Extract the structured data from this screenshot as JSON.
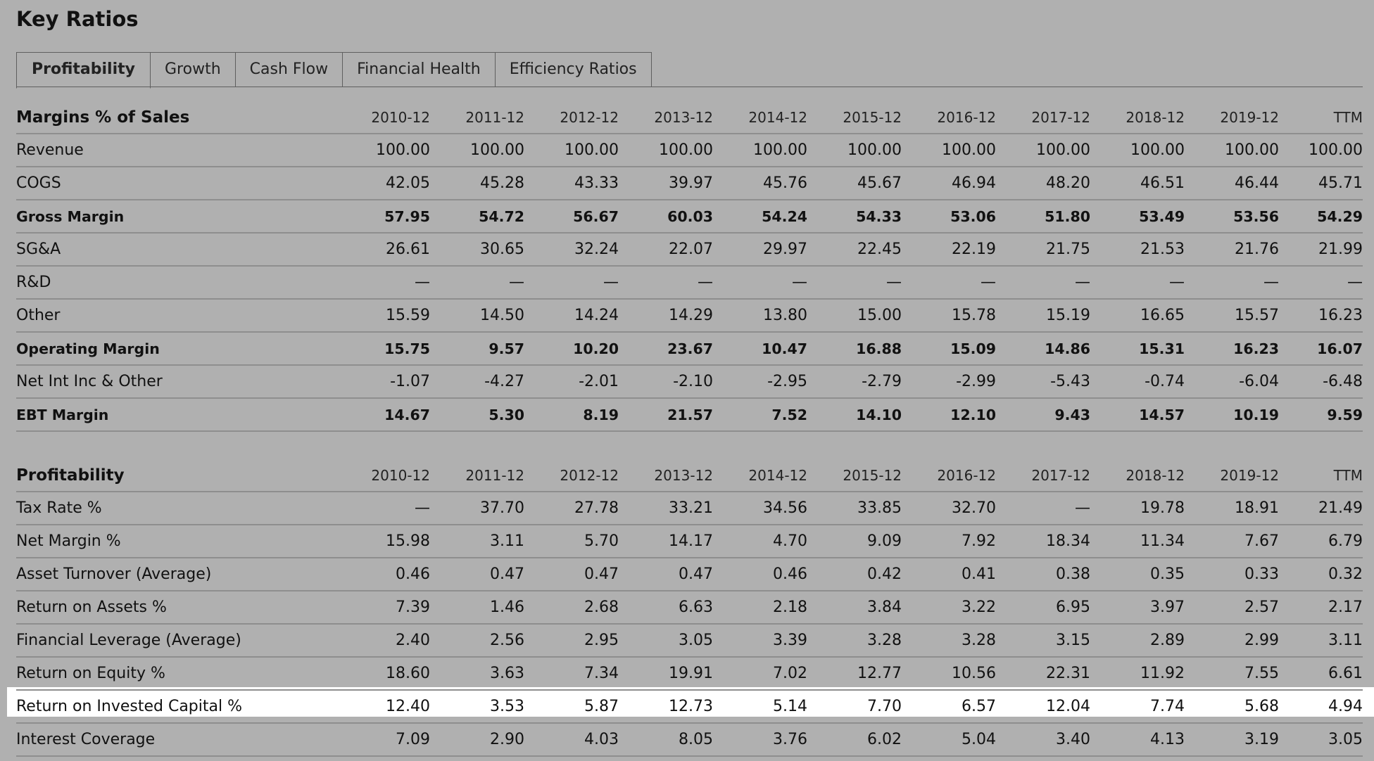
{
  "title": "Key Ratios",
  "tabs": [
    {
      "label": "Profitability",
      "active": true
    },
    {
      "label": "Growth",
      "active": false
    },
    {
      "label": "Cash Flow",
      "active": false
    },
    {
      "label": "Financial Health",
      "active": false
    },
    {
      "label": "Efficiency Ratios",
      "active": false
    }
  ],
  "margins": {
    "heading": "Margins % of Sales",
    "columns": [
      "2010-12",
      "2011-12",
      "2012-12",
      "2013-12",
      "2014-12",
      "2015-12",
      "2016-12",
      "2017-12",
      "2018-12",
      "2019-12",
      "TTM"
    ],
    "rows": [
      {
        "label": "Revenue",
        "bold": false,
        "values": [
          "100.00",
          "100.00",
          "100.00",
          "100.00",
          "100.00",
          "100.00",
          "100.00",
          "100.00",
          "100.00",
          "100.00",
          "100.00"
        ]
      },
      {
        "label": "COGS",
        "bold": false,
        "values": [
          "42.05",
          "45.28",
          "43.33",
          "39.97",
          "45.76",
          "45.67",
          "46.94",
          "48.20",
          "46.51",
          "46.44",
          "45.71"
        ]
      },
      {
        "label": "Gross Margin",
        "bold": true,
        "values": [
          "57.95",
          "54.72",
          "56.67",
          "60.03",
          "54.24",
          "54.33",
          "53.06",
          "51.80",
          "53.49",
          "53.56",
          "54.29"
        ]
      },
      {
        "label": "SG&A",
        "bold": false,
        "values": [
          "26.61",
          "30.65",
          "32.24",
          "22.07",
          "29.97",
          "22.45",
          "22.19",
          "21.75",
          "21.53",
          "21.76",
          "21.99"
        ]
      },
      {
        "label": "R&D",
        "bold": false,
        "values": [
          "—",
          "—",
          "—",
          "—",
          "—",
          "—",
          "—",
          "—",
          "—",
          "—",
          "—"
        ]
      },
      {
        "label": "Other",
        "bold": false,
        "values": [
          "15.59",
          "14.50",
          "14.24",
          "14.29",
          "13.80",
          "15.00",
          "15.78",
          "15.19",
          "16.65",
          "15.57",
          "16.23"
        ]
      },
      {
        "label": "Operating Margin",
        "bold": true,
        "values": [
          "15.75",
          "9.57",
          "10.20",
          "23.67",
          "10.47",
          "16.88",
          "15.09",
          "14.86",
          "15.31",
          "16.23",
          "16.07"
        ]
      },
      {
        "label": "Net Int Inc & Other",
        "bold": false,
        "values": [
          "-1.07",
          "-4.27",
          "-2.01",
          "-2.10",
          "-2.95",
          "-2.79",
          "-2.99",
          "-5.43",
          "-0.74",
          "-6.04",
          "-6.48"
        ]
      },
      {
        "label": "EBT Margin",
        "bold": true,
        "values": [
          "14.67",
          "5.30",
          "8.19",
          "21.57",
          "7.52",
          "14.10",
          "12.10",
          "9.43",
          "14.57",
          "10.19",
          "9.59"
        ]
      }
    ]
  },
  "profitability": {
    "heading": "Profitability",
    "columns": [
      "2010-12",
      "2011-12",
      "2012-12",
      "2013-12",
      "2014-12",
      "2015-12",
      "2016-12",
      "2017-12",
      "2018-12",
      "2019-12",
      "TTM"
    ],
    "rows": [
      {
        "label": "Tax Rate %",
        "highlight": false,
        "values": [
          "—",
          "37.70",
          "27.78",
          "33.21",
          "34.56",
          "33.85",
          "32.70",
          "—",
          "19.78",
          "18.91",
          "21.49"
        ]
      },
      {
        "label": "Net Margin %",
        "highlight": false,
        "values": [
          "15.98",
          "3.11",
          "5.70",
          "14.17",
          "4.70",
          "9.09",
          "7.92",
          "18.34",
          "11.34",
          "7.67",
          "6.79"
        ]
      },
      {
        "label": "Asset Turnover (Average)",
        "highlight": false,
        "values": [
          "0.46",
          "0.47",
          "0.47",
          "0.47",
          "0.46",
          "0.42",
          "0.41",
          "0.38",
          "0.35",
          "0.33",
          "0.32"
        ]
      },
      {
        "label": "Return on Assets %",
        "highlight": false,
        "values": [
          "7.39",
          "1.46",
          "2.68",
          "6.63",
          "2.18",
          "3.84",
          "3.22",
          "6.95",
          "3.97",
          "2.57",
          "2.17"
        ]
      },
      {
        "label": "Financial Leverage (Average)",
        "highlight": false,
        "values": [
          "2.40",
          "2.56",
          "2.95",
          "3.05",
          "3.39",
          "3.28",
          "3.28",
          "3.15",
          "2.89",
          "2.99",
          "3.11"
        ]
      },
      {
        "label": "Return on Equity %",
        "highlight": false,
        "values": [
          "18.60",
          "3.63",
          "7.34",
          "19.91",
          "7.02",
          "12.77",
          "10.56",
          "22.31",
          "11.92",
          "7.55",
          "6.61"
        ]
      },
      {
        "label": "Return on Invested Capital %",
        "highlight": true,
        "values": [
          "12.40",
          "3.53",
          "5.87",
          "12.73",
          "5.14",
          "7.70",
          "6.57",
          "12.04",
          "7.74",
          "5.68",
          "4.94"
        ]
      },
      {
        "label": "Interest Coverage",
        "highlight": false,
        "values": [
          "7.09",
          "2.90",
          "4.03",
          "8.05",
          "3.76",
          "6.02",
          "5.04",
          "3.40",
          "4.13",
          "3.19",
          "3.05"
        ]
      }
    ]
  }
}
